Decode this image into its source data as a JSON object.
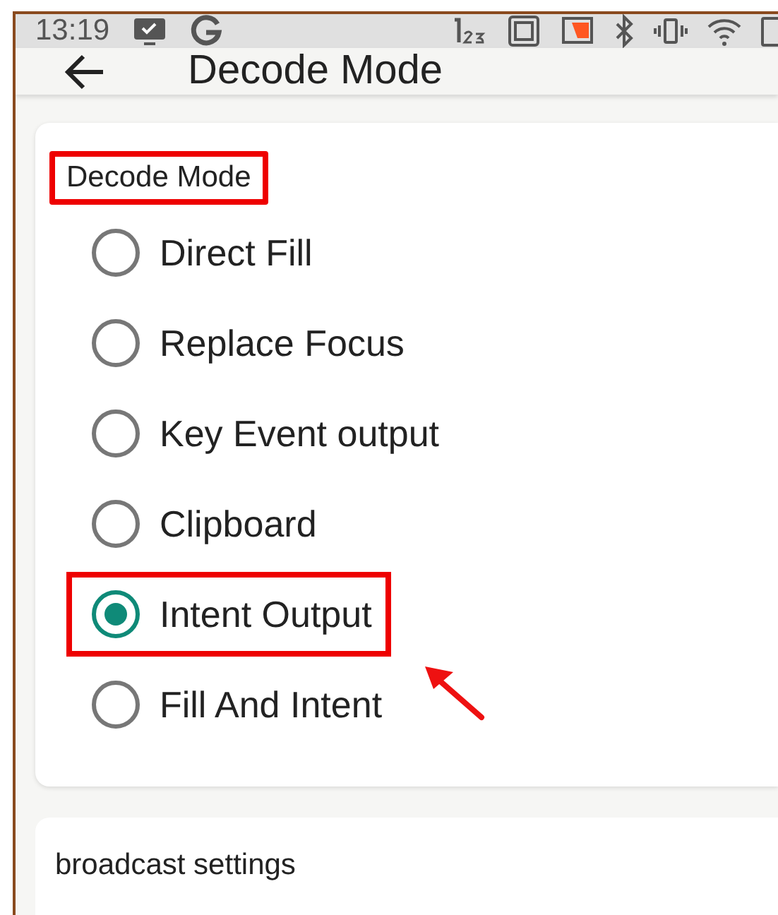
{
  "status_bar": {
    "time": "13:19"
  },
  "app_bar": {
    "title": "Decode Mode"
  },
  "decode_mode": {
    "title": "Decode Mode",
    "highlighted": true,
    "options": [
      {
        "label": "Direct Fill",
        "selected": false,
        "highlighted": false
      },
      {
        "label": "Replace Focus",
        "selected": false,
        "highlighted": false
      },
      {
        "label": "Key Event output",
        "selected": false,
        "highlighted": false
      },
      {
        "label": "Clipboard",
        "selected": false,
        "highlighted": false
      },
      {
        "label": "Intent Output",
        "selected": true,
        "highlighted": true
      },
      {
        "label": "Fill And Intent",
        "selected": false,
        "highlighted": false
      }
    ]
  },
  "broadcast": {
    "title": "broadcast settings"
  }
}
